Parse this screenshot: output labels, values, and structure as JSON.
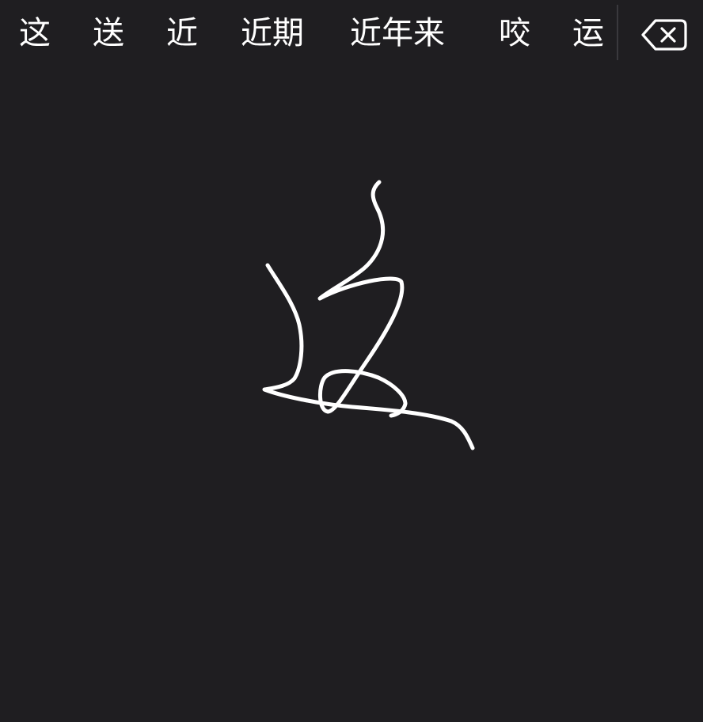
{
  "candidates": [
    "这",
    "送",
    "近",
    "近期",
    "近年来",
    "咬",
    "运"
  ],
  "delete_icon": "backspace-icon",
  "colors": {
    "background": "#1f1e21",
    "text": "#ffffff",
    "ink": "#ffffff",
    "divider": "#3a393d"
  }
}
